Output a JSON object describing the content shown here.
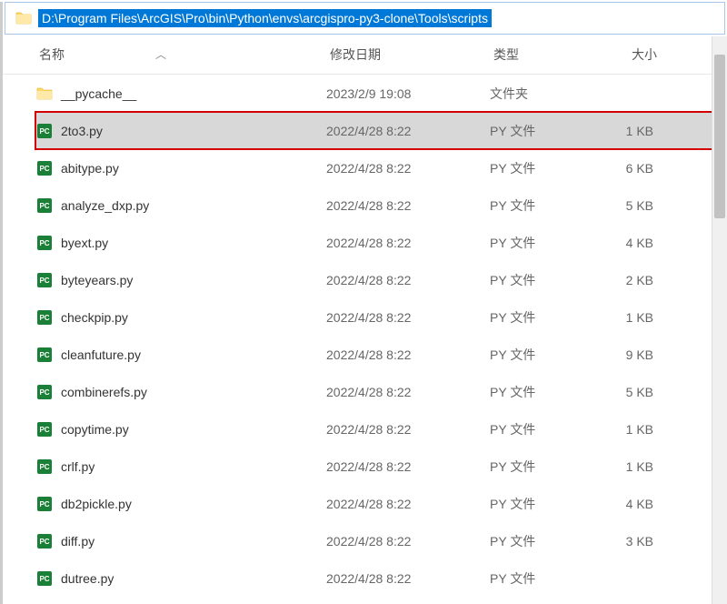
{
  "address": {
    "path": "D:\\Program Files\\ArcGIS\\Pro\\bin\\Python\\envs\\arcgispro-py3-clone\\Tools\\scripts"
  },
  "columns": {
    "name": "名称",
    "date": "修改日期",
    "type": "类型",
    "size": "大小"
  },
  "files": [
    {
      "name": "__pycache__",
      "date": "2023/2/9 19:08",
      "type": "文件夹",
      "size": "",
      "icon": "folder",
      "selected": false,
      "highlighted": false
    },
    {
      "name": "2to3.py",
      "date": "2022/4/28 8:22",
      "type": "PY 文件",
      "size": "1 KB",
      "icon": "py",
      "selected": true,
      "highlighted": true
    },
    {
      "name": "abitype.py",
      "date": "2022/4/28 8:22",
      "type": "PY 文件",
      "size": "6 KB",
      "icon": "py",
      "selected": false,
      "highlighted": false
    },
    {
      "name": "analyze_dxp.py",
      "date": "2022/4/28 8:22",
      "type": "PY 文件",
      "size": "5 KB",
      "icon": "py",
      "selected": false,
      "highlighted": false
    },
    {
      "name": "byext.py",
      "date": "2022/4/28 8:22",
      "type": "PY 文件",
      "size": "4 KB",
      "icon": "py",
      "selected": false,
      "highlighted": false
    },
    {
      "name": "byteyears.py",
      "date": "2022/4/28 8:22",
      "type": "PY 文件",
      "size": "2 KB",
      "icon": "py",
      "selected": false,
      "highlighted": false
    },
    {
      "name": "checkpip.py",
      "date": "2022/4/28 8:22",
      "type": "PY 文件",
      "size": "1 KB",
      "icon": "py",
      "selected": false,
      "highlighted": false
    },
    {
      "name": "cleanfuture.py",
      "date": "2022/4/28 8:22",
      "type": "PY 文件",
      "size": "9 KB",
      "icon": "py",
      "selected": false,
      "highlighted": false
    },
    {
      "name": "combinerefs.py",
      "date": "2022/4/28 8:22",
      "type": "PY 文件",
      "size": "5 KB",
      "icon": "py",
      "selected": false,
      "highlighted": false
    },
    {
      "name": "copytime.py",
      "date": "2022/4/28 8:22",
      "type": "PY 文件",
      "size": "1 KB",
      "icon": "py",
      "selected": false,
      "highlighted": false
    },
    {
      "name": "crlf.py",
      "date": "2022/4/28 8:22",
      "type": "PY 文件",
      "size": "1 KB",
      "icon": "py",
      "selected": false,
      "highlighted": false
    },
    {
      "name": "db2pickle.py",
      "date": "2022/4/28 8:22",
      "type": "PY 文件",
      "size": "4 KB",
      "icon": "py",
      "selected": false,
      "highlighted": false
    },
    {
      "name": "diff.py",
      "date": "2022/4/28 8:22",
      "type": "PY 文件",
      "size": "3 KB",
      "icon": "py",
      "selected": false,
      "highlighted": false
    },
    {
      "name": "dutree.py",
      "date": "2022/4/28 8:22",
      "type": "PY 文件",
      "size": "",
      "icon": "py",
      "selected": false,
      "highlighted": false
    }
  ]
}
